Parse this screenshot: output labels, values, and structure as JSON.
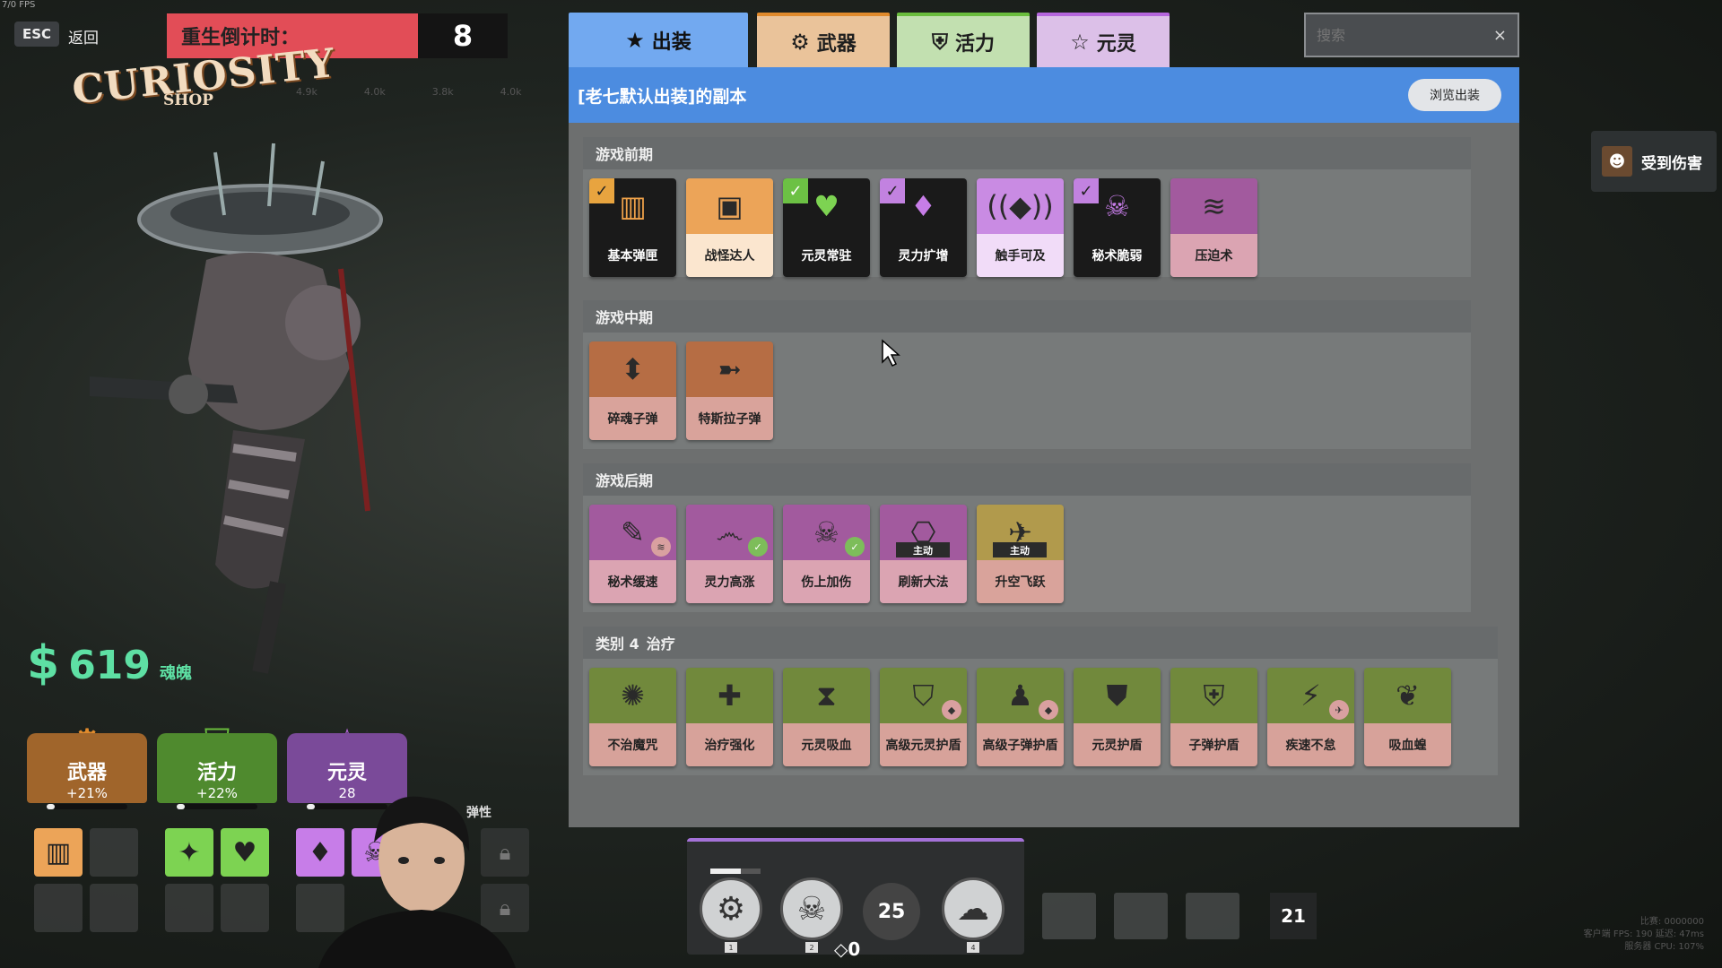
{
  "top_left": {
    "fps": "7/0 FPS",
    "esc_label": "ESC",
    "back_label": "返回",
    "respawn_label": "重生倒计时：",
    "respawn_seconds": "8"
  },
  "logo": {
    "main": "CURIOSITY",
    "sub": "SHOP"
  },
  "ghost_stats": [
    "4.9k",
    "4.0k",
    "3.8k",
    "4.0k"
  ],
  "money": {
    "amount": "619",
    "unit": "魂魄",
    "icon": "soul-currency-icon"
  },
  "stat_cards": {
    "weapon": {
      "name": "武器",
      "value": "+21%",
      "color": "#e08a2c",
      "progress": 0.1
    },
    "vitality": {
      "name": "活力",
      "value": "+22%",
      "color": "#6abd3d",
      "progress": 0.1
    },
    "spirit": {
      "name": "元灵",
      "value": "28",
      "color": "#b566dd",
      "progress": 0.1
    }
  },
  "elastic_label": "弹性",
  "tabs": {
    "build": "出装",
    "weapon": "武器",
    "vitality": "活力",
    "spirit": "元灵"
  },
  "search": {
    "placeholder": "搜索",
    "clear": "×"
  },
  "build_header": {
    "title": "[老七默认出装]的副本",
    "browse_button": "浏览出装"
  },
  "sections": {
    "early": {
      "title": "游戏前期",
      "items": [
        {
          "label": "基本弹匣",
          "icon": "magazine-icon",
          "checked": true
        },
        {
          "label": "战怪达人",
          "icon": "robot-icon",
          "checked": false
        },
        {
          "label": "元灵常驻",
          "icon": "heart-icon",
          "checked": true
        },
        {
          "label": "灵力扩增",
          "icon": "spirit-heart-icon",
          "checked": true
        },
        {
          "label": "触手可及",
          "icon": "signal-icon",
          "checked": false
        },
        {
          "label": "秘术脆弱",
          "icon": "skull-target-icon",
          "checked": true
        },
        {
          "label": "压迫术",
          "icon": "pressure-icon",
          "checked": false
        }
      ]
    },
    "mid": {
      "title": "游戏中期",
      "items": [
        {
          "label": "碎魂子弹",
          "icon": "shatter-bullet-icon"
        },
        {
          "label": "特斯拉子弹",
          "icon": "tesla-bullet-icon"
        }
      ]
    },
    "late": {
      "title": "游戏后期",
      "items": [
        {
          "label": "秘术缓速",
          "icon": "slow-hex-icon"
        },
        {
          "label": "灵力高涨",
          "icon": "spirit-surge-icon"
        },
        {
          "label": "伤上加伤",
          "icon": "damage-amp-icon"
        },
        {
          "label": "刷新大法",
          "icon": "refresher-icon",
          "tag": "主动"
        },
        {
          "label": "升空飞跃",
          "icon": "leap-icon",
          "tag": "主动"
        }
      ]
    },
    "category4": {
      "title": "类别 4",
      "subtitle": "治疗",
      "items": [
        {
          "label": "不治魔咒",
          "icon": "curse-icon"
        },
        {
          "label": "治疗强化",
          "icon": "heal-boost-icon"
        },
        {
          "label": "元灵吸血",
          "icon": "lifesteal-icon"
        },
        {
          "label": "高级元灵护盾",
          "icon": "spirit-shield-icon"
        },
        {
          "label": "高级子弹护盾",
          "icon": "bullet-shield-icon"
        },
        {
          "label": "元灵护盾",
          "icon": "spirit-shield-basic-icon"
        },
        {
          "label": "子弹护盾",
          "icon": "bullet-shield-basic-icon"
        },
        {
          "label": "疾速不怠",
          "icon": "speed-icon"
        },
        {
          "label": "吸血蝗",
          "icon": "leech-icon"
        }
      ]
    }
  },
  "damage_toast": {
    "text": "受到伤害"
  },
  "hud": {
    "ability_keys": [
      "1",
      "2",
      "4"
    ],
    "cooldown": "25",
    "souls_small": "◇0",
    "counter": "21"
  },
  "perf_text": [
    "比赛: 0000000",
    "客户端 FPS: 190  延迟: 47ms",
    "服务器 CPU: 107%"
  ]
}
